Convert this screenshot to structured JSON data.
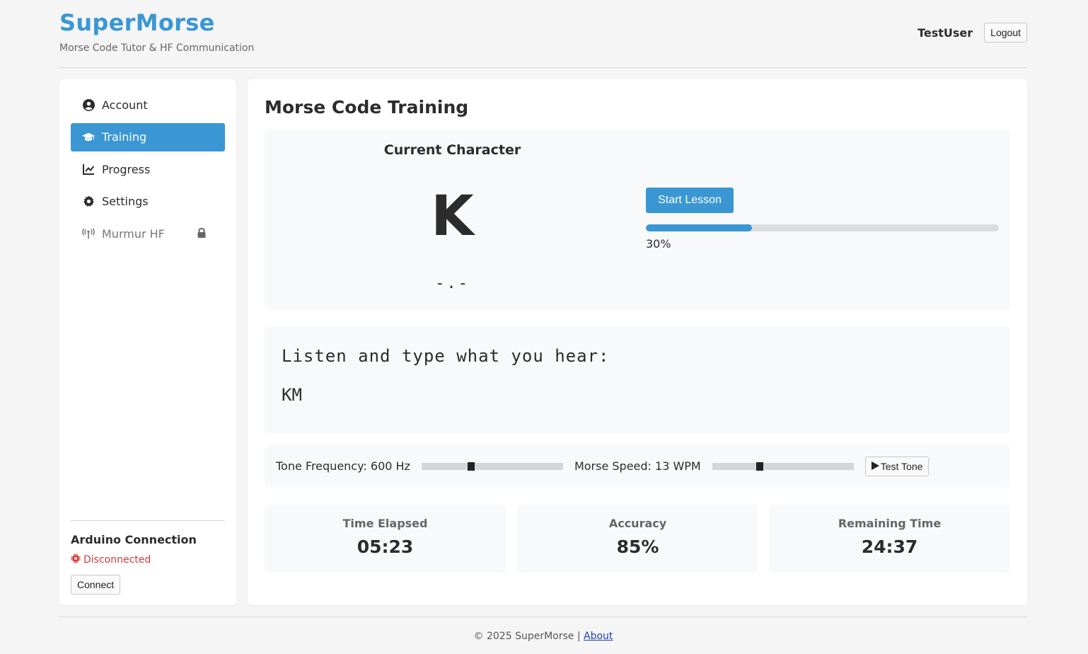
{
  "header": {
    "brand": "SuperMorse",
    "tagline": "Morse Code Tutor & HF Communication",
    "username": "TestUser",
    "logout_label": "Logout"
  },
  "sidebar": {
    "items": [
      {
        "label": "Account",
        "icon": "user-circle-icon",
        "active": false
      },
      {
        "label": "Training",
        "icon": "graduation-cap-icon",
        "active": true
      },
      {
        "label": "Progress",
        "icon": "line-chart-icon",
        "active": false
      },
      {
        "label": "Settings",
        "icon": "gear-icon",
        "active": false
      },
      {
        "label": "Murmur HF",
        "icon": "antenna-icon",
        "active": false,
        "locked": true
      }
    ],
    "arduino": {
      "title": "Arduino Connection",
      "status": "Disconnected",
      "status_color": "#d9373a",
      "connect_label": "Connect"
    }
  },
  "main": {
    "title": "Morse Code Training",
    "current_char_label": "Current Character",
    "current_char": "K",
    "morse_code": "-.-",
    "start_label": "Start Lesson",
    "progress": 30,
    "progress_text": "30%",
    "listen_prompt": "Listen and type what you hear:",
    "listen_answer": "KM",
    "tone_label": "Tone Frequency: 600 Hz",
    "tone_level": 0.34,
    "speed_label": "Morse Speed: 13 WPM",
    "speed_level": 0.33,
    "test_tone_label": "Test Tone",
    "stats": [
      {
        "label": "Time Elapsed",
        "value": "05:23"
      },
      {
        "label": "Accuracy",
        "value": "85%"
      },
      {
        "label": "Remaining Time",
        "value": "24:37"
      }
    ]
  },
  "footer": {
    "copyright": "© 2025 SuperMorse |",
    "about_label": "About"
  },
  "colors": {
    "accent": "#3a97d4",
    "background": "#f5f5f5",
    "panel": "#f8f9fa"
  }
}
